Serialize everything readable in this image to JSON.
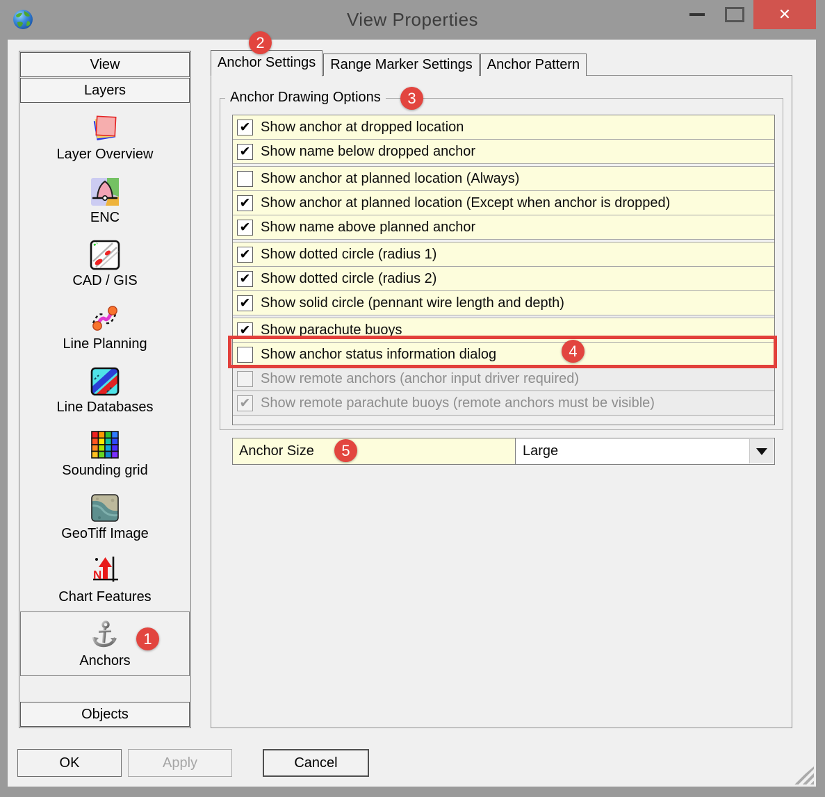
{
  "window": {
    "title": "View Properties",
    "controls": {
      "close": "✕"
    }
  },
  "sidebar": {
    "view_label": "View",
    "layers_label": "Layers",
    "objects_label": "Objects",
    "items": [
      {
        "label": "Layer Overview",
        "icon": "layer-overview-icon"
      },
      {
        "label": "ENC",
        "icon": "enc-icon"
      },
      {
        "label": "CAD / GIS",
        "icon": "cad-gis-icon"
      },
      {
        "label": "Line Planning",
        "icon": "line-planning-icon"
      },
      {
        "label": "Line Databases",
        "icon": "line-databases-icon"
      },
      {
        "label": "Sounding grid",
        "icon": "sounding-grid-icon"
      },
      {
        "label": "GeoTiff Image",
        "icon": "geotiff-image-icon"
      },
      {
        "label": "Chart Features",
        "icon": "chart-features-icon"
      },
      {
        "label": "Anchors",
        "icon": "anchor-icon",
        "selected": true
      }
    ]
  },
  "tabs": [
    {
      "label": "Anchor Settings",
      "active": true
    },
    {
      "label": "Range Marker Settings",
      "active": false
    },
    {
      "label": "Anchor Pattern",
      "active": false
    }
  ],
  "panel": {
    "group_title": "Anchor Drawing Options",
    "options": [
      {
        "label": "Show anchor at dropped location",
        "check": "✔",
        "checked": true,
        "disabled": false
      },
      {
        "label": "Show name below dropped anchor",
        "check": "✔",
        "checked": true,
        "disabled": false
      },
      {
        "label": "Show anchor at planned location (Always)",
        "check": "",
        "checked": false,
        "disabled": false
      },
      {
        "label": "Show anchor at planned location (Except when anchor is dropped)",
        "check": "✔",
        "checked": true,
        "disabled": false
      },
      {
        "label": "Show name above planned anchor",
        "check": "✔",
        "checked": true,
        "disabled": false
      },
      {
        "label": "Show dotted circle (radius 1)",
        "check": "✔",
        "checked": true,
        "disabled": false
      },
      {
        "label": "Show dotted circle (radius 2)",
        "check": "✔",
        "checked": true,
        "disabled": false
      },
      {
        "label": "Show solid circle (pennant wire length and depth)",
        "check": "✔",
        "checked": true,
        "disabled": false
      },
      {
        "label": "Show parachute buoys",
        "check": "✔",
        "checked": true,
        "disabled": false
      },
      {
        "label": "Show anchor status information dialog",
        "check": "",
        "checked": false,
        "disabled": false,
        "highlighted": true
      },
      {
        "label": "Show remote anchors (anchor input driver required)",
        "check": "",
        "checked": false,
        "disabled": true
      },
      {
        "label": "Show remote parachute buoys (remote anchors must be visible)",
        "check": "✔",
        "checked": true,
        "disabled": true
      }
    ],
    "anchor_size_label": "Anchor Size",
    "anchor_size_value": "Large"
  },
  "footer": {
    "ok": "OK",
    "apply": "Apply",
    "cancel": "Cancel"
  },
  "callouts": [
    {
      "n": "1"
    },
    {
      "n": "2"
    },
    {
      "n": "3"
    },
    {
      "n": "4"
    },
    {
      "n": "5"
    }
  ],
  "colors": {
    "titlebar": "#9A9A9A",
    "close_button_red": "#D1544E",
    "row_yellow": "#FDFDDC",
    "callout_red": "#E2453F",
    "highlight_red": "#E2403B"
  }
}
